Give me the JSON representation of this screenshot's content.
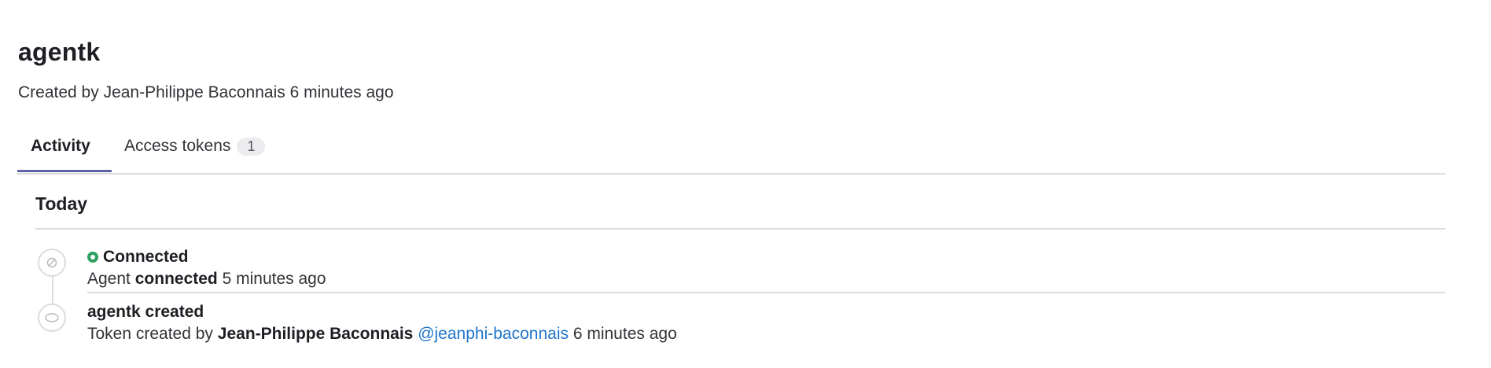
{
  "header": {
    "title": "agentk",
    "created_prefix": "Created by",
    "created_author": "Jean-Philippe Baconnais",
    "created_time": "6 minutes ago"
  },
  "tabs": [
    {
      "label": "Activity",
      "active": true
    },
    {
      "label": "Access tokens",
      "count": "1",
      "active": false
    }
  ],
  "section": {
    "title": "Today"
  },
  "events": [
    {
      "icon": "connection-icon",
      "title": "Connected",
      "status_color": "#2da160",
      "body_prefix": "Agent",
      "body_bold": "connected",
      "body_time": "5 minutes ago"
    },
    {
      "icon": "token-icon",
      "title": "agentk created",
      "body_prefix": "Token created by",
      "body_bold": "Jean-Philippe Baconnais",
      "body_link": "@jeanphi-baconnais",
      "body_time": "6 minutes ago"
    }
  ],
  "colors": {
    "accent": "#6062a8",
    "link": "#1f75cb",
    "success": "#2da160",
    "border": "#dcdcde"
  }
}
